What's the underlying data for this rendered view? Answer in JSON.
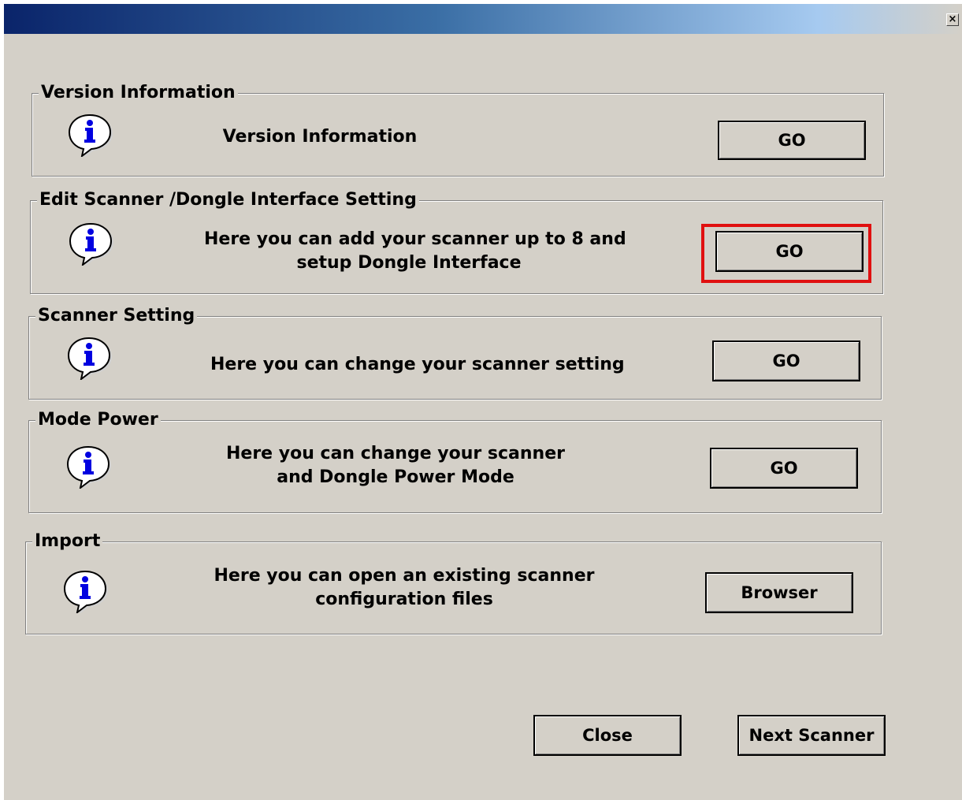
{
  "window": {
    "close_glyph": "×",
    "accent_highlight": "#e01010"
  },
  "groups": [
    {
      "legend": "Version Information",
      "icon": "info-icon",
      "desc_lines": [
        "Version Information"
      ],
      "button": "GO"
    },
    {
      "legend": "Edit Scanner /Dongle Interface Setting",
      "icon": "info-icon",
      "desc_lines": [
        "Here you can add your scanner up to 8 and",
        "setup Dongle Interface"
      ],
      "button": "GO"
    },
    {
      "legend": "Scanner Setting",
      "icon": "info-icon",
      "desc_lines": [
        "Here you can change your scanner setting"
      ],
      "button": "GO"
    },
    {
      "legend": "Mode Power",
      "icon": "info-icon",
      "desc_lines": [
        "Here you can change your scanner",
        "and Dongle Power Mode"
      ],
      "button": "GO"
    },
    {
      "legend": "Import",
      "icon": "info-icon",
      "desc_lines": [
        "Here you can open an existing scanner",
        "configuration files"
      ],
      "button": "Browser"
    }
  ],
  "footer": {
    "close_label": "Close",
    "next_label": "Next Scanner"
  }
}
